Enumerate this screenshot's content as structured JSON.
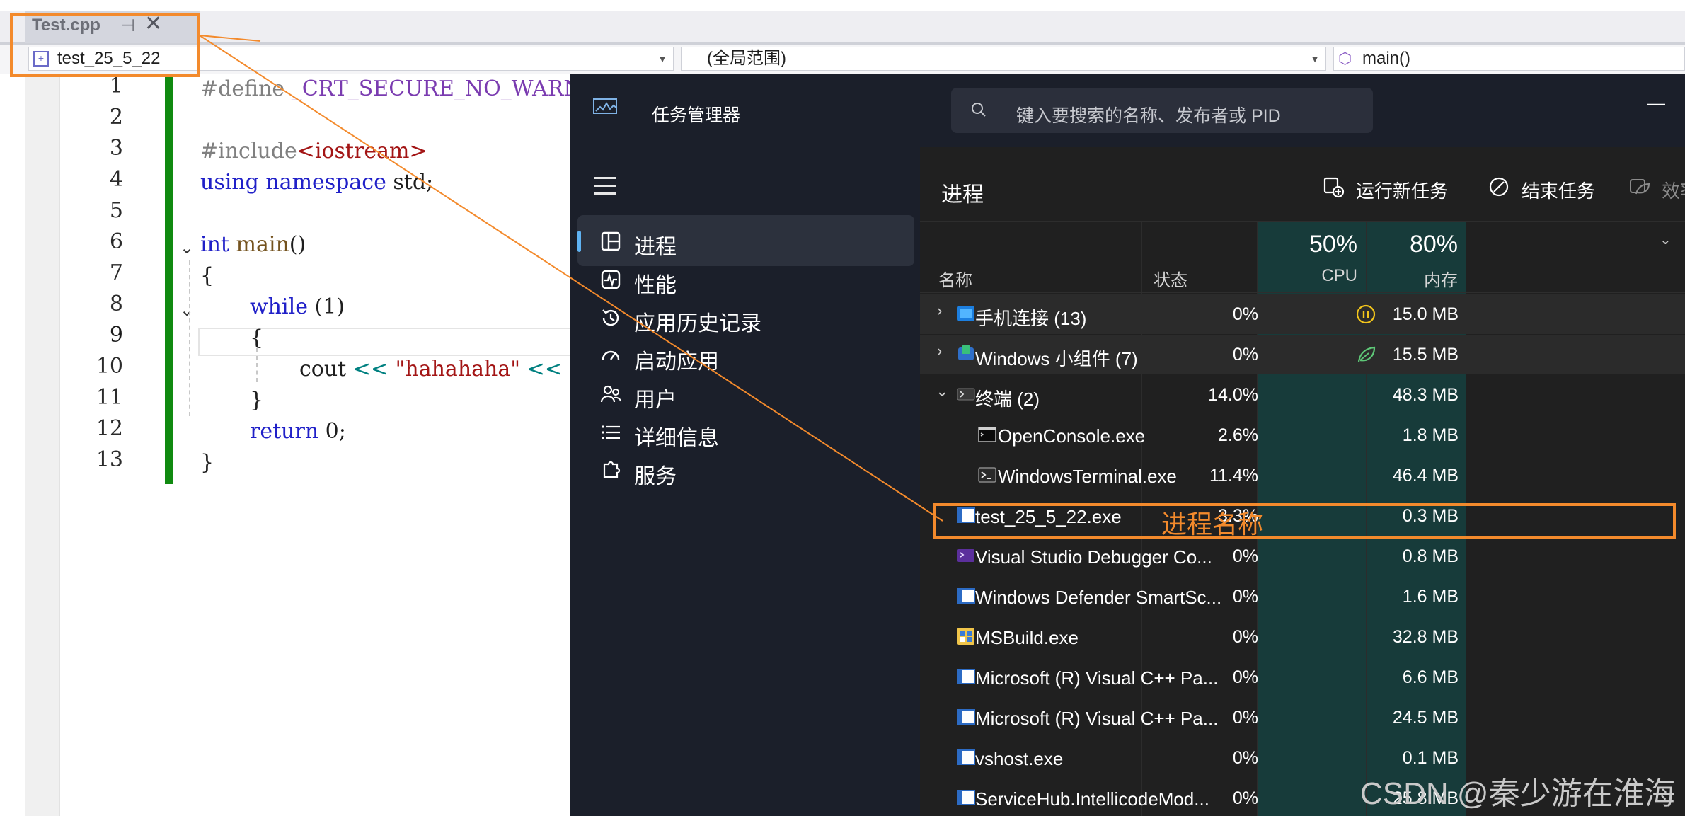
{
  "vs": {
    "tab_title": "Test.cpp",
    "tab_pin": "⊣",
    "tab_close": "✕",
    "project_combo": "test_25_5_22",
    "scope_combo": "(全局范围)",
    "member_combo": "main()",
    "line_numbers": [
      "1",
      "2",
      "3",
      "4",
      "5",
      "6",
      "7",
      "8",
      "9",
      "10",
      "11",
      "12",
      "13"
    ]
  },
  "code": {
    "l1a": "#define ",
    "l1b": "_CRT_SECURE_NO_WARNIN",
    "l3a": "#include",
    "l3b": "<iostream>",
    "l4a": "using",
    "l4b": " namespace",
    "l4c": " std;",
    "l6a": "int",
    "l6b": " main",
    "l6c": "()",
    "l7": "{",
    "l8a": "while",
    "l8b": " (1)",
    "l9": "{",
    "l10a": "cout",
    "l10b": " << ",
    "l10c": "\"hahahaha\"",
    "l10d": " <<",
    "l11": "}",
    "l12a": "return",
    "l12b": " 0;",
    "l13": "}"
  },
  "tm": {
    "app_title": "任务管理器",
    "search_placeholder": "键入要搜索的名称、发布者或 PID",
    "minimize": "—",
    "nav": [
      {
        "label": "进程"
      },
      {
        "label": "性能"
      },
      {
        "label": "应用历史记录"
      },
      {
        "label": "启动应用"
      },
      {
        "label": "用户"
      },
      {
        "label": "详细信息"
      },
      {
        "label": "服务"
      }
    ],
    "page_title": "进程",
    "actions": {
      "run": "运行新任务",
      "end": "结束任务",
      "efficiency": "效率"
    },
    "columns": {
      "name": "名称",
      "status": "状态",
      "cpu_pct": "50%",
      "cpu": "CPU",
      "mem_pct": "80%",
      "mem": "内存"
    },
    "rows": [
      {
        "name": "手机连接 (13)",
        "cpu": "0%",
        "mem": "15.0 MB",
        "expander": "›",
        "status": "paused"
      },
      {
        "name": "Windows 小组件 (7)",
        "cpu": "0%",
        "mem": "15.5 MB",
        "expander": "›",
        "status": "efficiency"
      },
      {
        "name": "终端 (2)",
        "cpu": "14.0%",
        "mem": "48.3 MB",
        "expander": "⌄"
      },
      {
        "name": "OpenConsole.exe",
        "cpu": "2.6%",
        "mem": "1.8 MB"
      },
      {
        "name": "WindowsTerminal.exe",
        "cpu": "11.4%",
        "mem": "46.4 MB"
      },
      {
        "name": "test_25_5_22.exe",
        "cpu": "3.3%",
        "mem": "0.3 MB"
      },
      {
        "name": "Visual Studio Debugger Co...",
        "cpu": "0%",
        "mem": "0.8 MB"
      },
      {
        "name": "Windows Defender SmartSc...",
        "cpu": "0%",
        "mem": "1.6 MB"
      },
      {
        "name": "MSBuild.exe",
        "cpu": "0%",
        "mem": "32.8 MB"
      },
      {
        "name": "Microsoft (R) Visual C++ Pa...",
        "cpu": "0%",
        "mem": "6.6 MB"
      },
      {
        "name": "Microsoft (R) Visual C++ Pa...",
        "cpu": "0%",
        "mem": "24.5 MB"
      },
      {
        "name": "vshost.exe",
        "cpu": "0%",
        "mem": "0.1 MB"
      },
      {
        "name": "ServiceHub.IntellicodeMod...",
        "cpu": "0%",
        "mem": "25.8 MB"
      }
    ]
  },
  "annotation": {
    "label": "进程名称",
    "color": "#f38a2c"
  },
  "watermark": "CSDN @秦少游在淮海",
  "colors": {
    "accent": "#5fb2f2",
    "vs_change_bar": "#108a10",
    "tm_bg": "#202020",
    "tm_sidebar": "#1b1f2a",
    "cpu_col": "#173b3a"
  }
}
